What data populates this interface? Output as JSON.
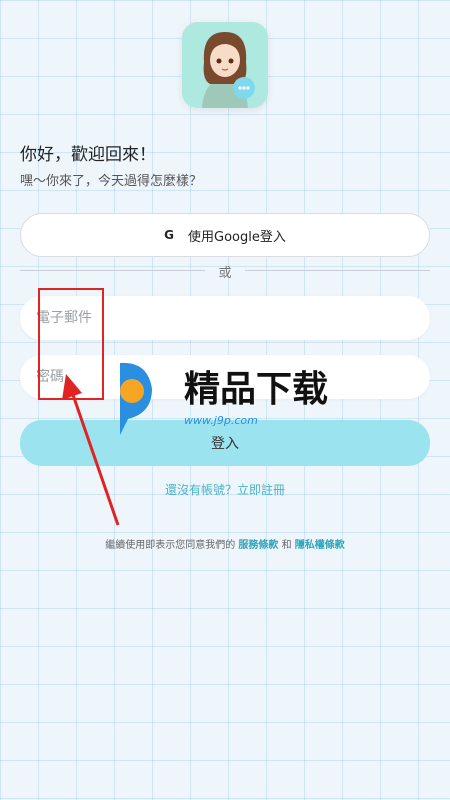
{
  "header": {
    "greeting": "你好，歡迎回來！",
    "subtitle": "嘿～你來了，今天過得怎麼樣？"
  },
  "login": {
    "google_icon": "G",
    "google_label": "使用Google登入",
    "divider_text": "或",
    "email_placeholder": "電子郵件",
    "password_placeholder": "密碼",
    "submit_label": "登入"
  },
  "signup": {
    "label": "還沒有帳號？立即註冊"
  },
  "terms": {
    "prefix": "繼續使用即表示您同意我們的 ",
    "service_link": "服務條款",
    "middle": " 和 ",
    "privacy_link": "隱私權條款"
  },
  "watermark": {
    "brand_text": "精品下载",
    "url_text": "www.j9p.com"
  },
  "colors": {
    "accent": "#9ae3ef",
    "link": "#4ab3c6",
    "annotation": "#e02424"
  }
}
